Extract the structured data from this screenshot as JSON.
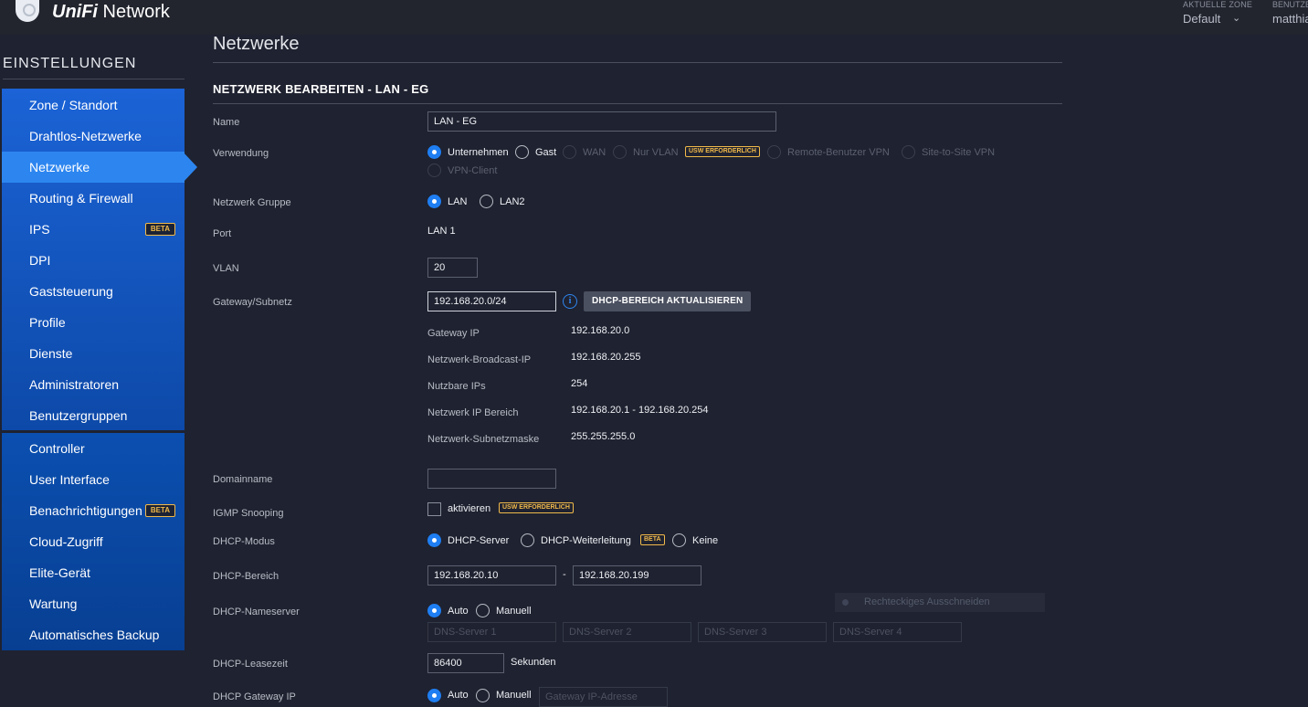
{
  "header": {
    "brand_bold": "UniFi",
    "brand_rest": " Network",
    "zone_label": "AKTUELLE ZONE",
    "zone_value": "Default",
    "user_label": "BENUTZER",
    "user_value": "matthias"
  },
  "sidebar": {
    "heading": "EINSTELLUNGEN",
    "group1": [
      {
        "label": "Zone / Standort"
      },
      {
        "label": "Drahtlos-Netzwerke"
      },
      {
        "label": "Netzwerke"
      },
      {
        "label": "Routing & Firewall"
      },
      {
        "label": "IPS",
        "badge": "BETA"
      },
      {
        "label": "DPI"
      },
      {
        "label": "Gaststeuerung"
      },
      {
        "label": "Profile"
      },
      {
        "label": "Dienste"
      },
      {
        "label": "Administratoren"
      },
      {
        "label": "Benutzergruppen"
      }
    ],
    "group2": [
      {
        "label": "Controller"
      },
      {
        "label": "User Interface"
      },
      {
        "label": "Benachrichtigungen",
        "badge": "BETA"
      },
      {
        "label": "Cloud-Zugriff"
      },
      {
        "label": "Elite-Gerät"
      },
      {
        "label": "Wartung"
      },
      {
        "label": "Automatisches Backup"
      }
    ],
    "active": "Netzwerke"
  },
  "page": {
    "title": "Netzwerke",
    "section_title": "NETZWERK BEARBEITEN - LAN - EG"
  },
  "form": {
    "name": {
      "label": "Name",
      "value": "LAN - EG"
    },
    "usage": {
      "label": "Verwendung",
      "options": [
        "Unternehmen",
        "Gast",
        "WAN",
        "Nur VLAN",
        "Remote-Benutzer VPN",
        "Site-to-Site VPN",
        "VPN-Client"
      ],
      "selected": "Unternehmen",
      "usw_tag": "USW ERFORDERLICH"
    },
    "network_group": {
      "label": "Netzwerk Gruppe",
      "options": [
        "LAN",
        "LAN2"
      ],
      "selected": "LAN"
    },
    "port": {
      "label": "Port",
      "value": "LAN 1"
    },
    "vlan": {
      "label": "VLAN",
      "value": "20"
    },
    "gateway": {
      "label": "Gateway/Subnetz",
      "value": "192.168.20.0/24",
      "info_icon": "info-icon",
      "button": "DHCP-BEREICH AKTUALISIEREN"
    },
    "details": [
      {
        "label": "Gateway IP",
        "value": "192.168.20.0"
      },
      {
        "label": "Netzwerk-Broadcast-IP",
        "value": "192.168.20.255"
      },
      {
        "label": "Nutzbare IPs",
        "value": "254"
      },
      {
        "label": "Netzwerk IP Bereich",
        "value": "192.168.20.1 - 192.168.20.254"
      },
      {
        "label": "Netzwerk-Subnetzmaske",
        "value": "255.255.255.0"
      }
    ],
    "domain": {
      "label": "Domainname",
      "value": ""
    },
    "igmp": {
      "label": "IGMP Snooping",
      "checkbox_label": "aktivieren",
      "checked": false,
      "tag": "USW ERFORDERLICH"
    },
    "dhcp_mode": {
      "label": "DHCP-Modus",
      "options": [
        "DHCP-Server",
        "DHCP-Weiterleitung",
        "Keine"
      ],
      "selected": "DHCP-Server",
      "beta": "BETA"
    },
    "dhcp_range": {
      "label": "DHCP-Bereich",
      "start": "192.168.20.10",
      "separator": "-",
      "end": "192.168.20.199"
    },
    "dhcp_ns": {
      "label": "DHCP-Nameserver",
      "options": [
        "Auto",
        "Manuell"
      ],
      "selected": "Auto",
      "placeholders": [
        "DNS-Server 1",
        "DNS-Server 2",
        "DNS-Server 3",
        "DNS-Server 4"
      ]
    },
    "lease": {
      "label": "DHCP-Leasezeit",
      "value": "86400",
      "unit": "Sekunden"
    },
    "dhcp_gateway": {
      "label": "DHCP Gateway IP",
      "options": [
        "Auto",
        "Manuell"
      ],
      "selected": "Auto",
      "placeholder": "Gateway IP-Adresse"
    }
  },
  "overlay": {
    "label": "Rechteckiges Ausschneiden"
  },
  "colors": {
    "accent": "#1e7ef2",
    "sidebar": "#1b63d6",
    "active": "#2d86f0",
    "badge": "#f0b94a",
    "background": "#1f2230"
  }
}
